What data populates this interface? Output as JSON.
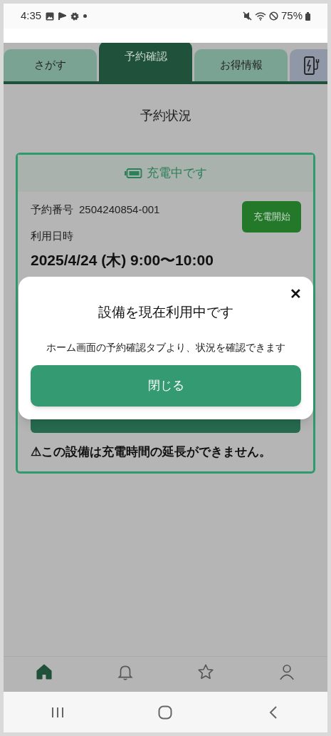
{
  "status_bar": {
    "time": "4:35",
    "battery": "75%"
  },
  "tabs": [
    {
      "label": "さがす",
      "selected": false,
      "kind": "text"
    },
    {
      "label": "予約確認",
      "selected": true,
      "kind": "text"
    },
    {
      "label": "お得情報",
      "selected": false,
      "kind": "text"
    },
    {
      "selected": false,
      "kind": "charger"
    }
  ],
  "page_title": "予約状況",
  "reservation": {
    "status": "充電中です",
    "number_label": "予約番号",
    "number": "2504240854-001",
    "start_button": "充電開始",
    "date_label": "利用日時",
    "date": "2025/4/24 (木) 9:00〜10:00",
    "notice": "⚠この設備は充電時間の延長ができません。"
  },
  "dialog": {
    "title": "設備を現在利用中です",
    "message": "ホーム画面の予約確認タブより、状況を確認できます",
    "close_button": "閉じる",
    "close_icon": "✕"
  },
  "bottom_nav": [
    {
      "kind": "home",
      "selected": true
    },
    {
      "kind": "bell",
      "selected": false
    },
    {
      "kind": "star",
      "selected": false
    },
    {
      "kind": "person",
      "selected": false
    }
  ]
}
